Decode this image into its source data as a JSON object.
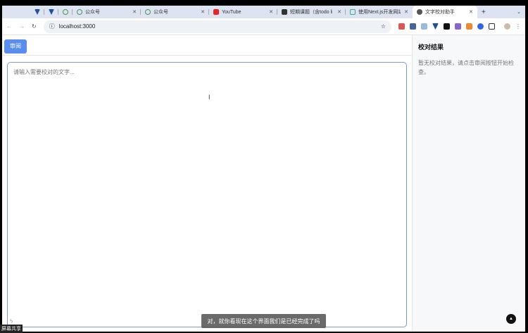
{
  "browser": {
    "tabs": [
      {
        "label": "",
        "icon": "vue-icon"
      },
      {
        "label": "",
        "icon": "vue-icon"
      },
      {
        "label": "",
        "icon": "cloud-icon"
      },
      {
        "label": "公众号",
        "icon": "cloud-icon"
      },
      {
        "label": "公众号",
        "icon": "cloud-icon"
      },
      {
        "label": "YouTube",
        "icon": "youtube-icon"
      },
      {
        "label": "短期课题（含todo list",
        "icon": "notion-icon"
      },
      {
        "label": "使用Next.js开发网站",
        "icon": "page-icon"
      },
      {
        "label": "文字校对助手",
        "icon": "globe-icon"
      }
    ],
    "url": "localhost:3000"
  },
  "toolbar": {
    "review_label": "审阅"
  },
  "editor": {
    "placeholder": "请输入需要校对的文字..."
  },
  "results": {
    "title": "校对结果",
    "empty_message": "暂无校对结果，请点击审阅按钮开始检查。"
  },
  "overlay": {
    "caption": "对，就你看现在这个界面我们是已经完成了吗",
    "screen_share": "屏幕共享"
  }
}
